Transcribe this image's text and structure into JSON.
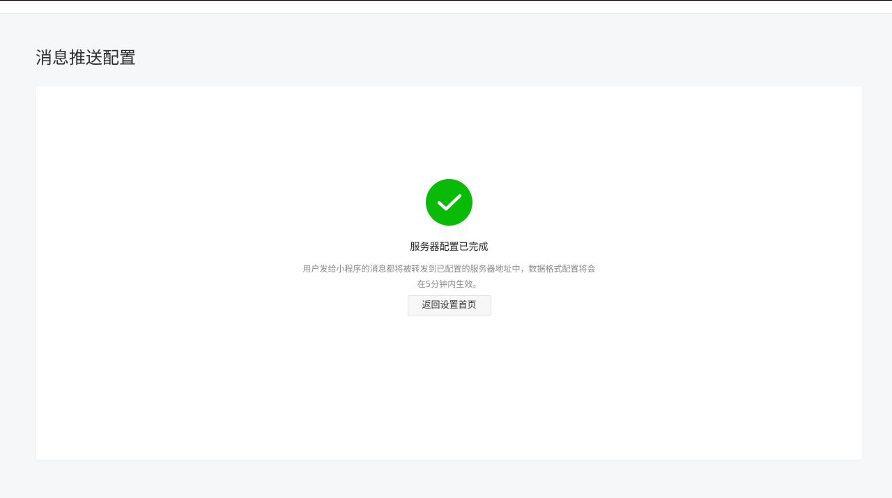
{
  "page": {
    "title": "消息推送配置"
  },
  "result": {
    "icon": "check-circle-icon",
    "icon_color": "#09bb07",
    "title": "服务器配置已完成",
    "description": "用户发给小程序的消息都将被转发到已配置的服务器地址中，数据格式配置将会在5分钟内生效。",
    "back_button_label": "返回设置首页"
  }
}
